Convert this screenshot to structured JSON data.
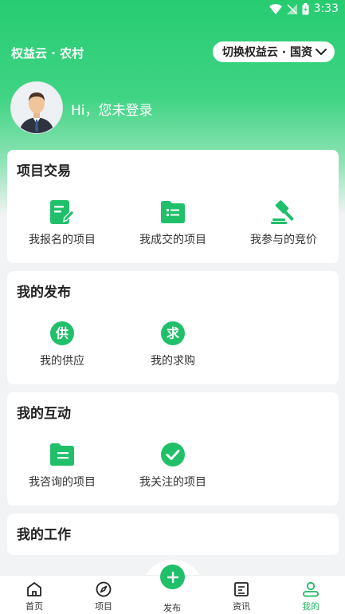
{
  "status": {
    "time": "3:33"
  },
  "header": {
    "region_label": "权益云 · 农村",
    "switch_label": "切换权益云 · 国资",
    "greeting": "Hi，您未登录"
  },
  "sections": [
    {
      "title": "项目交易",
      "items": [
        {
          "label": "我报名的项目",
          "icon": "edit-document-icon"
        },
        {
          "label": "我成交的项目",
          "icon": "list-folder-icon"
        },
        {
          "label": "我参与的竞价",
          "icon": "gavel-icon"
        }
      ]
    },
    {
      "title": "我的发布",
      "items": [
        {
          "label": "我的供应",
          "icon": "supply-icon",
          "glyph": "供"
        },
        {
          "label": "我的求购",
          "icon": "demand-icon",
          "glyph": "求"
        }
      ]
    },
    {
      "title": "我的互动",
      "items": [
        {
          "label": "我咨询的项目",
          "icon": "folder-icon"
        },
        {
          "label": "我关注的项目",
          "icon": "check-circle-icon"
        }
      ]
    },
    {
      "title": "我的工作",
      "items": []
    }
  ],
  "tabbar": {
    "tabs": [
      {
        "label": "首页",
        "icon": "home-icon"
      },
      {
        "label": "项目",
        "icon": "compass-icon"
      },
      {
        "label": "发布",
        "icon": "plus-icon"
      },
      {
        "label": "资讯",
        "icon": "news-icon"
      },
      {
        "label": "我的",
        "icon": "person-icon",
        "active": true
      }
    ]
  },
  "colors": {
    "brand": "#1fc069",
    "active_tab": "#1fb862"
  }
}
